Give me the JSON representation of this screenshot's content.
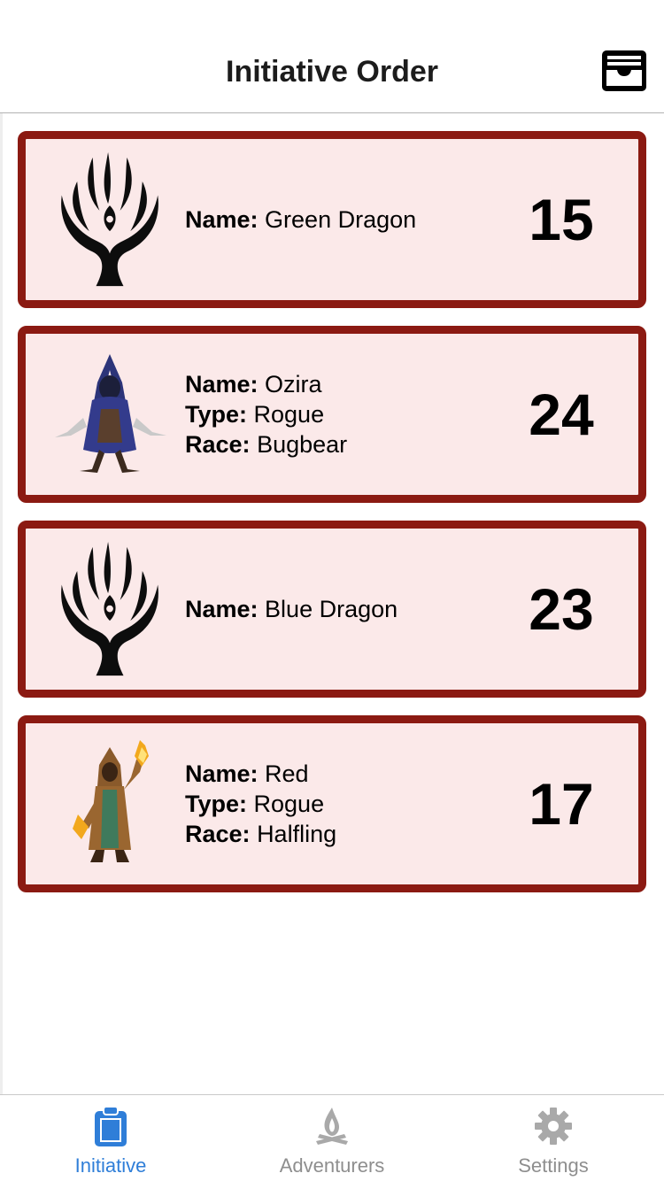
{
  "nav": {
    "title": "Initiative Order",
    "right_icon": "inbox-tray-icon"
  },
  "entries": [
    {
      "avatar": "dragon-emblem",
      "name_label": "Name:",
      "name": "Green Dragon",
      "score": "15"
    },
    {
      "avatar": "hooded-rogue-sprite",
      "name_label": "Name:",
      "name": "Ozira",
      "type_label": "Type:",
      "type": "Rogue",
      "race_label": "Race:",
      "race": "Bugbear",
      "score": "24"
    },
    {
      "avatar": "dragon-emblem",
      "name_label": "Name:",
      "name": "Blue Dragon",
      "score": "23"
    },
    {
      "avatar": "fire-mage-sprite",
      "name_label": "Name:",
      "name": "Red",
      "type_label": "Type:",
      "type": "Rogue",
      "race_label": "Race:",
      "race": "Halfling",
      "score": "17"
    }
  ],
  "tabs": [
    {
      "label": "Initiative",
      "icon": "clipboard-icon",
      "active": true
    },
    {
      "label": "Adventurers",
      "icon": "campfire-icon",
      "active": false
    },
    {
      "label": "Settings",
      "icon": "gear-icon",
      "active": false
    }
  ],
  "colors": {
    "card_background": "#fbe9e9",
    "card_border": "#8b1a12",
    "active_tab": "#2f7ed8",
    "inactive_tab": "#8e8e8e"
  }
}
